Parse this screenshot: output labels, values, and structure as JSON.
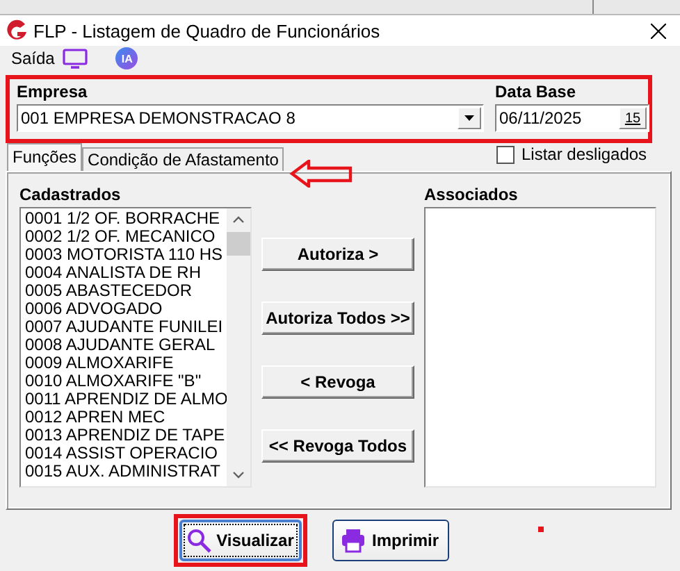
{
  "window": {
    "title": "FLP - Listagem de Quadro de Funcionários"
  },
  "toolbar": {
    "label": "Saída",
    "ia_badge": "IA"
  },
  "empresa": {
    "label": "Empresa",
    "value": "001 EMPRESA DEMONSTRACAO 8"
  },
  "data_base": {
    "label": "Data Base",
    "value": "06/11/2025",
    "calendar_button": "15"
  },
  "listar_desligados": {
    "label": "Listar desligados",
    "checked": false
  },
  "tabs": [
    {
      "label": "Funções",
      "selected": true
    },
    {
      "label": "Condição de Afastamento",
      "selected": false
    }
  ],
  "cadastrados": {
    "label": "Cadastrados",
    "items": [
      "0001 1/2 OF. BORRACHE",
      "0002 1/2 OF. MECANICO",
      "0003 MOTORISTA 110 HS",
      "0004 ANALISTA DE RH",
      "0005 ABASTECEDOR",
      "0006 ADVOGADO",
      "0007 AJUDANTE FUNILEI",
      "0008 AJUDANTE GERAL",
      "0009 ALMOXARIFE",
      "0010 ALMOXARIFE \"B\"",
      "0011 APRENDIZ DE ALMO",
      "0012 APREN MEC",
      "0013 APRENDIZ DE TAPE",
      "0014 ASSIST OPERACIO",
      "0015 AUX. ADMINISTRAT"
    ]
  },
  "actions": [
    "Autoriza >",
    "Autoriza Todos >>",
    "< Revoga",
    "<< Revoga Todos"
  ],
  "associados": {
    "label": "Associados"
  },
  "buttons": [
    {
      "label": "Visualizar",
      "kind": "preview",
      "focused": true
    },
    {
      "label": "Imprimir",
      "kind": "print",
      "focused": false
    }
  ]
}
